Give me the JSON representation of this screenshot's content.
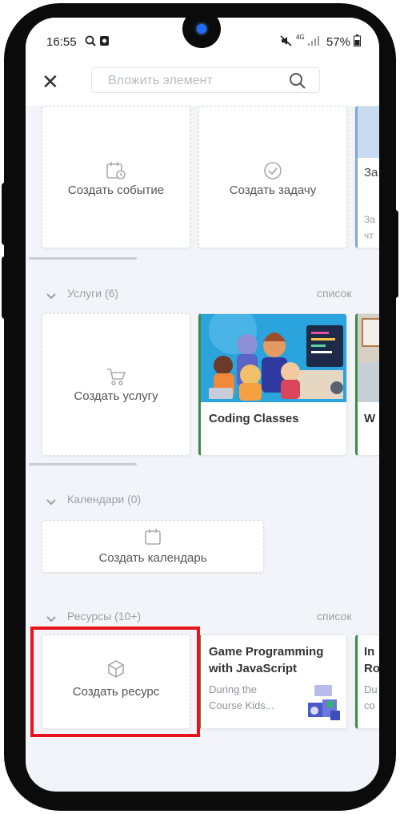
{
  "status": {
    "time": "16:55",
    "battery": "57%",
    "network": "4G"
  },
  "search": {
    "placeholder": "Вложить элемент"
  },
  "top_row": {
    "create_event": "Создать событие",
    "create_task": "Создать задачу",
    "partial_title": "За",
    "partial_sub1": "За",
    "partial_sub2": "чт"
  },
  "services": {
    "header": "Услуги (6)",
    "link": "список",
    "create_label": "Создать услугу",
    "card_title": "Coding Classes",
    "partial_title": "W"
  },
  "calendars": {
    "header": "Календари (0)",
    "create_label": "Создать календарь"
  },
  "resources": {
    "header": "Ресурсы (10+)",
    "link": "список",
    "create_label": "Создать ресурс",
    "card_title_line1": "Game Programming",
    "card_title_line2": "with JavaScript",
    "card_desc_line1": "During the",
    "card_desc_line2": "Course Kids...",
    "partial_title1": "In",
    "partial_title2": "Ro",
    "partial_sub1": "Du",
    "partial_sub2": "co"
  },
  "colors": {
    "accent_green": "#3c8a4a",
    "highlight_red": "#e8131b",
    "blue_camera": "#1f6cff"
  }
}
